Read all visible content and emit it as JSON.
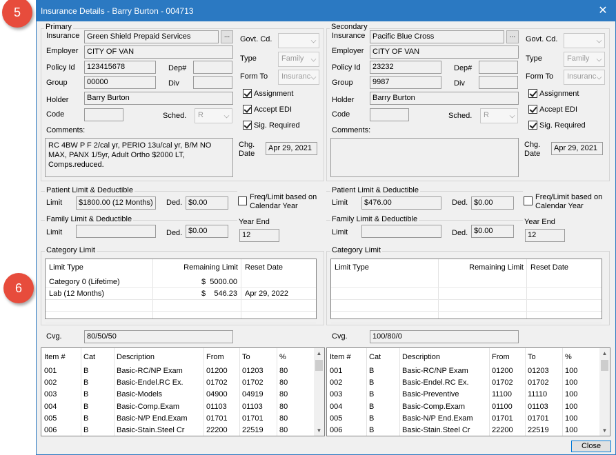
{
  "window": {
    "title": "Insurance Details - Barry Burton - 004713",
    "close_glyph": "✕"
  },
  "badges": [
    "5",
    "6"
  ],
  "primary": {
    "group_title": "Primary",
    "insurance_label": "Insurance",
    "insurance": "Green Shield Prepaid Services",
    "employer_label": "Employer",
    "employer": "CITY OF VAN",
    "policy_label": "Policy Id",
    "policy": "123415678",
    "dep_label": "Dep#",
    "dep": "",
    "group_label": "Group",
    "group": "00000",
    "div_label": "Div",
    "div": "",
    "holder_label": "Holder",
    "holder": "Barry Burton",
    "code_label": "Code",
    "code": "",
    "sched_label": "Sched.",
    "sched": "R",
    "comments_label": "Comments:",
    "comments": "RC 4BW P F 2/cal yr, PERIO 13u/cal yr, B/M NO MAX, PANX 1/5yr, Adult Ortho $2000 LT, Comps.reduced.",
    "govt_label": "Govt. Cd.",
    "govt": "",
    "type_label": "Type",
    "type": "Family",
    "formto_label": "Form To",
    "formto": "Insuranc",
    "assignment_label": "Assignment",
    "edi_label": "Accept EDI",
    "sig_label": "Sig. Required",
    "chg_label1": "Chg.",
    "chg_label2": "Date",
    "chg_date": "Apr 29, 2021",
    "patient_limit_title": "Patient Limit & Deductible",
    "limit_label": "Limit",
    "patient_limit": "$1800.00  (12 Months)",
    "ded_label": "Ded.",
    "patient_ded": "$0.00",
    "freq_label1": "Freq/Limit based on",
    "freq_label2": "Calendar Year",
    "family_limit_title": "Family Limit & Deductible",
    "family_limit": "",
    "family_ded": "$0.00",
    "year_end_label": "Year End",
    "year_end": "12",
    "category_title": "Category Limit",
    "cat_headers": [
      "Limit Type",
      "Remaining Limit",
      "Reset Date"
    ],
    "cat_rows": [
      {
        "type": "Category 0  (Lifetime)",
        "cur": "$",
        "amount": "5000.00",
        "reset": ""
      },
      {
        "type": "Lab (12 Months)",
        "cur": "$",
        "amount": "546.23",
        "reset": "Apr 29, 2022"
      }
    ],
    "cvg_label": "Cvg.",
    "cvg": "80/50/50",
    "item_headers": [
      "Item #",
      "Cat",
      "Description",
      "From",
      "To",
      "%"
    ],
    "items": [
      [
        "001",
        "B",
        "Basic-RC/NP Exam",
        "01200",
        "01203",
        "80"
      ],
      [
        "002",
        "B",
        "Basic-Endel.RC Ex.",
        "01702",
        "01702",
        "80"
      ],
      [
        "003",
        "B",
        "Basic-Models",
        "04900",
        "04919",
        "80"
      ],
      [
        "004",
        "B",
        "Basic-Comp.Exam",
        "01103",
        "01103",
        "80"
      ],
      [
        "005",
        "B",
        "Basic-N/P End.Exam",
        "01701",
        "01701",
        "80"
      ],
      [
        "006",
        "B",
        "Basic-Stain.Steel Cr",
        "22200",
        "22519",
        "80"
      ]
    ]
  },
  "secondary": {
    "group_title": "Secondary",
    "insurance_label": "Insurance",
    "insurance": "Pacific Blue Cross",
    "employer_label": "Employer",
    "employer": "CITY OF VAN",
    "policy_label": "Policy Id",
    "policy": "23232",
    "dep_label": "Dep#",
    "dep": "",
    "group_label": "Group",
    "group": "9987",
    "div_label": "Div",
    "div": "",
    "holder_label": "Holder",
    "holder": "Barry Burton",
    "code_label": "Code",
    "code": "",
    "sched_label": "Sched.",
    "sched": "R",
    "comments_label": "Comments:",
    "comments": "",
    "govt_label": "Govt. Cd.",
    "govt": "",
    "type_label": "Type",
    "type": "Family",
    "formto_label": "Form To",
    "formto": "Insuranc",
    "assignment_label": "Assignment",
    "edi_label": "Accept EDI",
    "sig_label": "Sig. Required",
    "chg_label1": "Chg.",
    "chg_label2": "Date",
    "chg_date": "Apr 29, 2021",
    "patient_limit_title": "Patient Limit & Deductible",
    "limit_label": "Limit",
    "patient_limit": "$476.00",
    "ded_label": "Ded.",
    "patient_ded": "$0.00",
    "freq_label1": "Freq/Limit based on",
    "freq_label2": "Calendar Year",
    "family_limit_title": "Family Limit & Deductible",
    "family_limit": "",
    "family_ded": "$0.00",
    "year_end_label": "Year End",
    "year_end": "12",
    "category_title": "Category Limit",
    "cat_headers": [
      "Limit Type",
      "Remaining Limit",
      "Reset Date"
    ],
    "cat_rows": [],
    "cvg_label": "Cvg.",
    "cvg": "100/80/0",
    "item_headers": [
      "Item #",
      "Cat",
      "Description",
      "From",
      "To",
      "%"
    ],
    "items": [
      [
        "001",
        "B",
        "Basic-RC/NP Exam",
        "01200",
        "01203",
        "100"
      ],
      [
        "002",
        "B",
        "Basic-Endel.RC Ex.",
        "01702",
        "01702",
        "100"
      ],
      [
        "003",
        "B",
        "Basic-Preventive",
        "11100",
        "11110",
        "100"
      ],
      [
        "004",
        "B",
        "Basic-Comp.Exam",
        "01100",
        "01103",
        "100"
      ],
      [
        "005",
        "B",
        "Basic-N/P End.Exam",
        "01701",
        "01701",
        "100"
      ],
      [
        "006",
        "B",
        "Basic-Stain.Steel Cr",
        "22200",
        "22519",
        "100"
      ]
    ]
  },
  "footer": {
    "close_label": "Close"
  }
}
